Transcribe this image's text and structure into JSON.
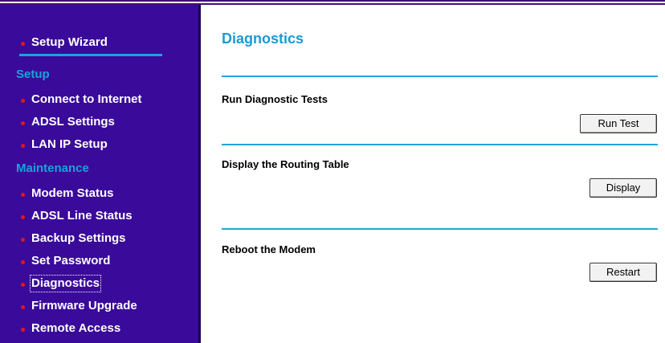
{
  "colors": {
    "sidebar_bg": "#3a0a9a",
    "accent_blue": "#19a4d8",
    "bullet_red": "#e01818"
  },
  "sidebar": {
    "setup_wizard": "Setup Wizard",
    "setup_heading": "Setup",
    "setup_items": [
      "Connect to Internet",
      "ADSL Settings",
      "LAN IP Setup"
    ],
    "maintenance_heading": "Maintenance",
    "maintenance_items": [
      "Modem Status",
      "ADSL Line Status",
      "Backup Settings",
      "Set Password",
      "Diagnostics",
      "Firmware Upgrade",
      "Remote Access"
    ],
    "active_item": "Diagnostics"
  },
  "main": {
    "title": "Diagnostics",
    "sections": [
      {
        "heading": "Run Diagnostic Tests",
        "button": "Run Test"
      },
      {
        "heading": "Display the Routing Table",
        "button": "Display"
      },
      {
        "heading": "Reboot the Modem",
        "button": "Restart"
      }
    ]
  }
}
